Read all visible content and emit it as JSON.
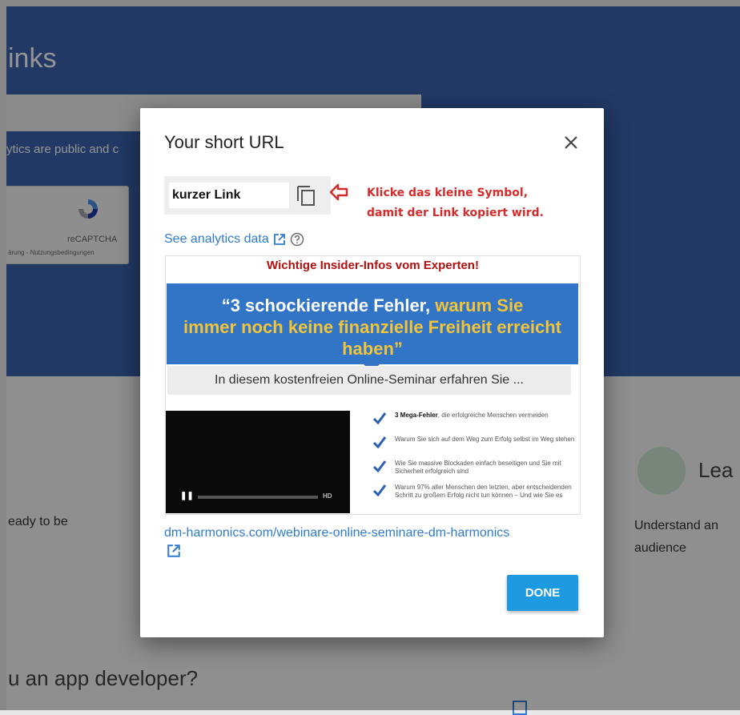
{
  "background": {
    "header_title": "inks",
    "notice_text": "ytics are public and c",
    "captcha_label": "reCAPTCHA",
    "captcha_links": "ärung - Nutzungsbedingungen",
    "left_text": "eady to be",
    "right_title": "Lea",
    "right_text": "Understand an audience",
    "bottom_question": "u an app developer?",
    "colors": {
      "header": "#3a62ad"
    }
  },
  "modal": {
    "title": "Your short URL",
    "close_icon": "close-icon",
    "short_url_value": "kurzer Link",
    "copy_icon": "copy-icon",
    "annotation": "Klicke das kleine Symbol,\ndamit der Link kopiert wird.",
    "analytics_link": "See analytics data",
    "preview": {
      "header": "Wichtige Insider-Infos vom Experten!",
      "banner_white_1": "“3 schockierende Fehler, ",
      "banner_gold_1": "warum Sie",
      "banner_gold_2": "immer noch keine finanzielle Freiheit erreicht haben”",
      "subtitle": "In diesem kostenfreien Online-Seminar erfahren Sie ...",
      "video_hd": "HD",
      "bullets": [
        {
          "bold": "3 Mega-Fehler",
          "text": ", die erfolgreiche Menschen vermeiden"
        },
        {
          "bold": "",
          "text": "Warum Sie sich auf dem Weg zum Erfolg selbst im Weg stehen"
        },
        {
          "bold": "",
          "text": "Wie Sie massive Blockaden einfach beseitigen und Sie mit Sicherheit erfolgreich sind"
        },
        {
          "bold": "",
          "text": "Warum 97% aller Menschen den letzten, aber entscheidenden Schritt zu großem Erfolg nicht tun können – Und wie Sie es"
        }
      ]
    },
    "target_url": "dm-harmonics.com/webinare-online-seminare-dm-harmonics",
    "done_label": "DONE",
    "colors": {
      "accent": "#1e9be0",
      "link": "#2f7bd1",
      "annotation": "#d62b2b"
    }
  }
}
